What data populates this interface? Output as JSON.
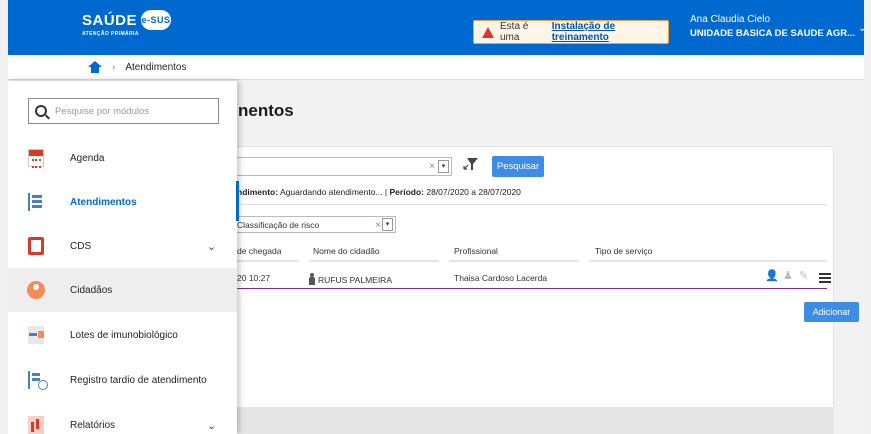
{
  "header": {
    "logo_text": "SAÚDE",
    "logo_badge": "e-SUS",
    "logo_sub": "ATENÇÃO PRIMÁRIA",
    "training_text": "Esta é uma",
    "training_link": "Instalação de treinamento",
    "user_name": "Ana Claudia Cielo",
    "user_unit": "UNIDADE BASICA DE SAUDE AGR..."
  },
  "breadcrumb": {
    "current": "Atendimentos"
  },
  "page": {
    "title_visible": "nentos"
  },
  "filters": {
    "status_prefix": "ndimento:",
    "status_value": "Aguardando atendimento...",
    "period_label": "Período:",
    "period_value": "28/07/2020 a 28/07/2020",
    "search_button": "Pesquisar",
    "risk_placeholder": "Classificação de risco"
  },
  "table": {
    "headers": [
      "de chegada",
      "Nome do cidadão",
      "Profissional",
      "Tipo de serviço"
    ],
    "rows": [
      {
        "arrival": "20 10:27",
        "citizen": "RUFUS PALMEIRA",
        "professional": "Thaisa Cardoso Lacerda",
        "service": ""
      }
    ]
  },
  "add_button": "Adicionar",
  "drawer": {
    "search_placeholder": "Pesquise por módulos",
    "items": [
      {
        "label": "Agenda",
        "icon": "calendar-icon"
      },
      {
        "label": "Atendimentos",
        "icon": "attendance-icon",
        "active": true
      },
      {
        "label": "CDS",
        "icon": "cds-icon",
        "expandable": true
      },
      {
        "label": "Cidadãos",
        "icon": "citizen-icon"
      },
      {
        "label": "Lotes de imunobiológico",
        "icon": "vaccine-lot-icon"
      },
      {
        "label": "Registro tardio de atendimento",
        "icon": "late-record-icon"
      },
      {
        "label": "Relatórios",
        "icon": "reports-icon",
        "expandable": true
      }
    ]
  },
  "colors": {
    "brand": "#0069d0",
    "accent_button": "#3d8ce6",
    "row_marker": "#7b2c8a"
  }
}
